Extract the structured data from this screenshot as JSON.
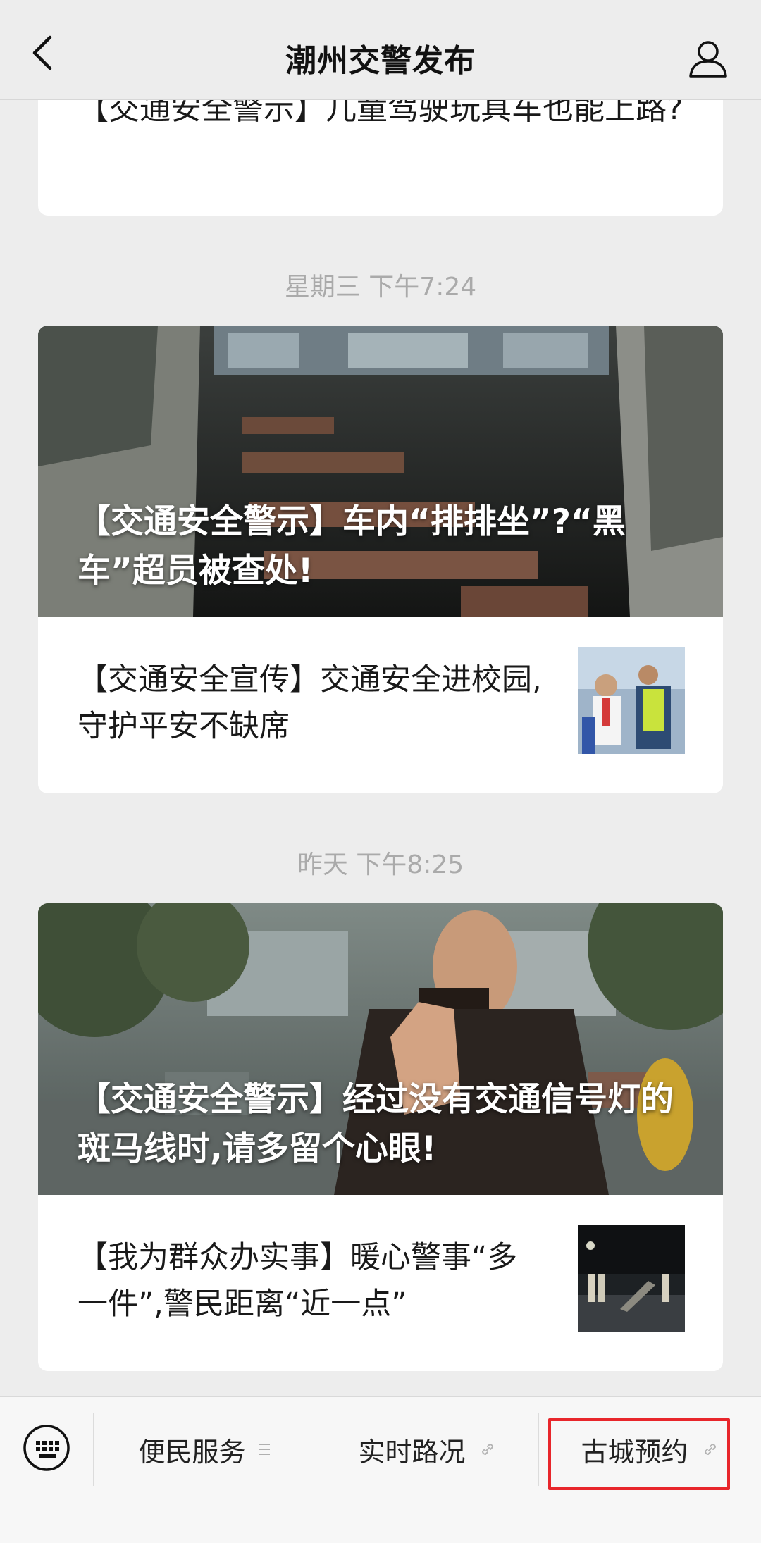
{
  "header": {
    "title": "潮州交警发布",
    "back_icon": "chevron-left-icon",
    "profile_icon": "user-icon"
  },
  "feed": {
    "partial_card": {
      "title": "【交通安全警示】儿童驾驶玩具车也能上路?"
    },
    "groups": [
      {
        "time": "星期三 下午7:24",
        "hero_title": "【交通安全警示】车内“排排坐”?“黑车”超员被查处!",
        "sub_articles": [
          {
            "title": "【交通安全宣传】交通安全进校园,守护平安不缺席"
          }
        ]
      },
      {
        "time": "昨天 下午8:25",
        "hero_title": "【交通安全警示】经过没有交通信号灯的斑马线时,请多留个心眼!",
        "sub_articles": [
          {
            "title": "【我为群众办实事】暖心警事“多一件”,警民距离“近一点”"
          }
        ]
      }
    ]
  },
  "bottom_menu": {
    "keyboard_icon": "keyboard-icon",
    "items": [
      {
        "label": "便民服务",
        "icon": "menu-lines-icon"
      },
      {
        "label": "实时路况",
        "icon": "link-icon"
      },
      {
        "label": "古城预约",
        "icon": "link-icon"
      }
    ],
    "highlight_color": "#e8262b"
  }
}
